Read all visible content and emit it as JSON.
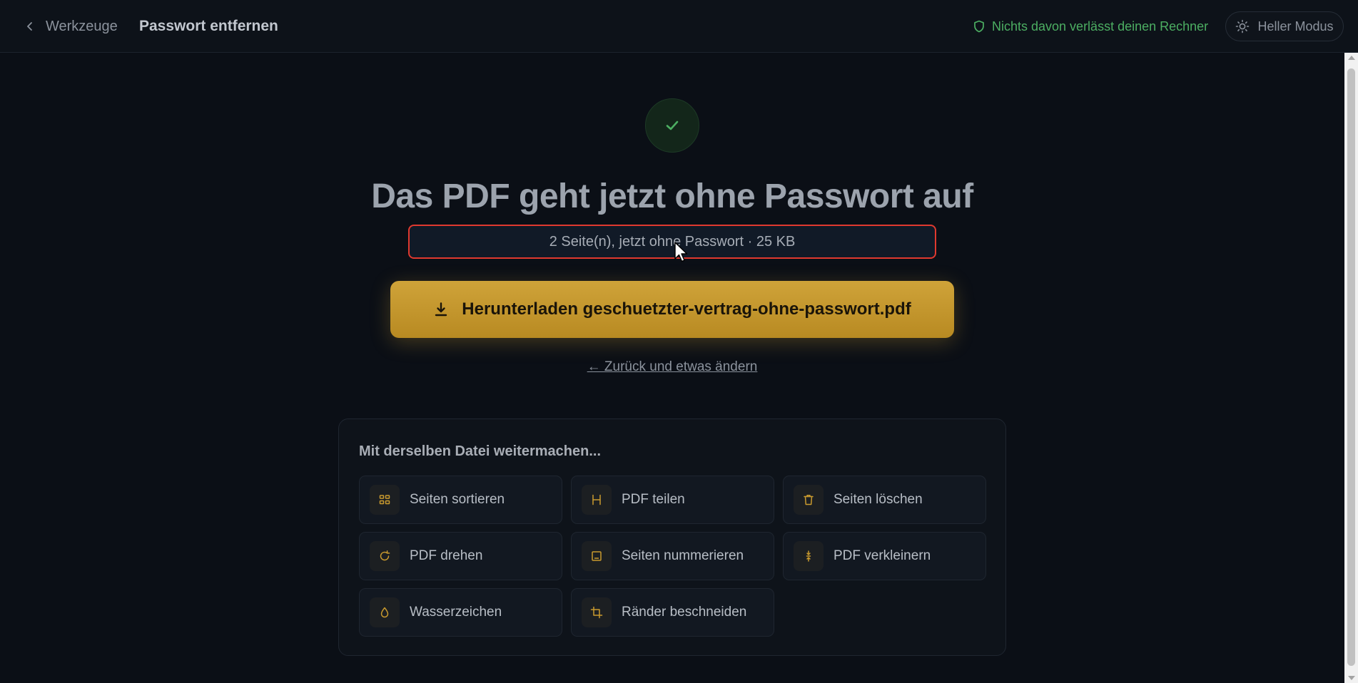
{
  "header": {
    "back_label": "Werkzeuge",
    "title": "Passwort entfernen",
    "privacy_text": "Nichts davon verlässt deinen Rechner",
    "mode_label": "Heller Modus"
  },
  "result": {
    "headline": "Das PDF geht jetzt ohne Passwort auf",
    "info": "2 Seite(n), jetzt ohne Passwort · 25 KB",
    "download_label": "Herunterladen geschuetzter-vertrag-ohne-passwort.pdf",
    "back_change_label": "← Zurück und etwas ändern"
  },
  "continue": {
    "title": "Mit derselben Datei weitermachen...",
    "tools": [
      {
        "label": "Seiten sortieren",
        "icon": "grid-icon"
      },
      {
        "label": "PDF teilen",
        "icon": "split-icon"
      },
      {
        "label": "Seiten löschen",
        "icon": "trash-icon"
      },
      {
        "label": "PDF drehen",
        "icon": "rotate-icon"
      },
      {
        "label": "Seiten nummerieren",
        "icon": "page-number-icon"
      },
      {
        "label": "PDF verkleinern",
        "icon": "compress-icon"
      },
      {
        "label": "Wasserzeichen",
        "icon": "droplet-icon"
      },
      {
        "label": "Ränder beschneiden",
        "icon": "crop-icon"
      }
    ]
  },
  "colors": {
    "accent": "#c99a2e",
    "success": "#4cae62",
    "highlight_border": "#e0392f",
    "background": "#0b0f16"
  }
}
